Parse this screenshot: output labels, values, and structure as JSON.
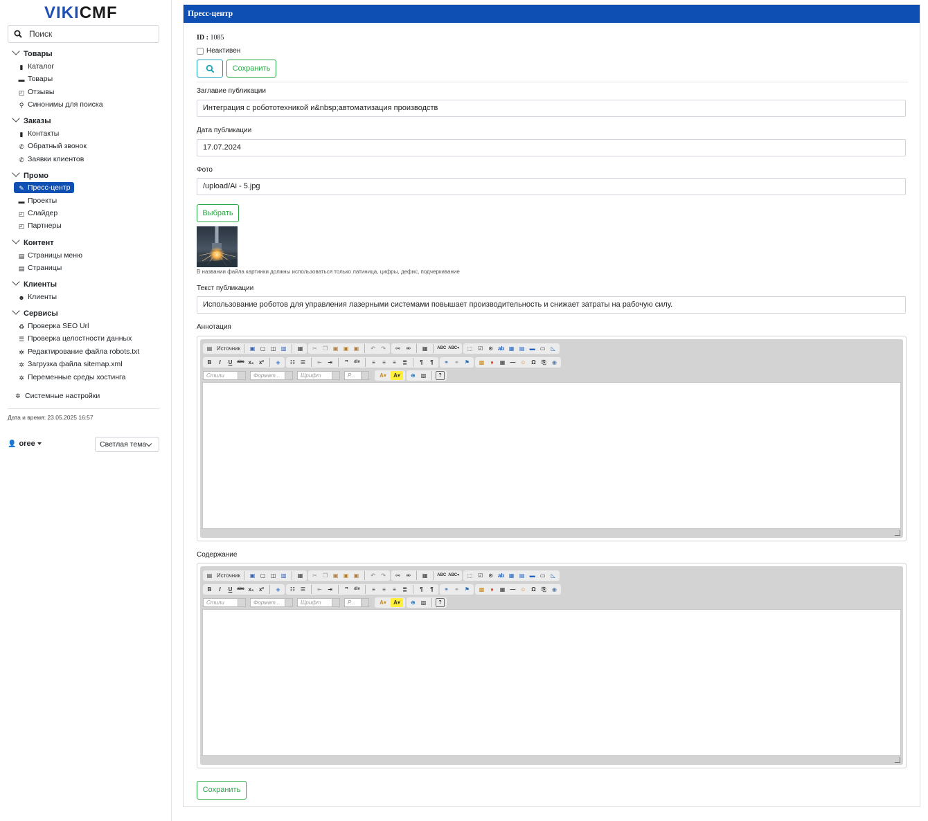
{
  "sidebar": {
    "logo_part1": "VIKI",
    "logo_part2": "CMF",
    "search_placeholder": "Поиск",
    "groups": [
      {
        "title": "Товары",
        "items": [
          "Каталог",
          "Товары",
          "Отзывы",
          "Синонимы для поиска"
        ]
      },
      {
        "title": "Заказы",
        "items": [
          "Контакты",
          "Обратный звонок",
          "Заявки клиентов"
        ]
      },
      {
        "title": "Промо",
        "items": [
          "Пресс-центр",
          "Проекты",
          "Слайдер",
          "Партнеры"
        ]
      },
      {
        "title": "Контент",
        "items": [
          "Страницы меню",
          "Страницы"
        ]
      },
      {
        "title": "Клиенты",
        "items": [
          "Клиенты"
        ]
      },
      {
        "title": "Сервисы",
        "items": [
          "Проверка SEO Url",
          "Проверка целостности данных",
          "Редактирование файла robots.txt",
          "Загрузка файла sitemap.xml",
          "Переменные среды хостинга"
        ]
      }
    ],
    "system_settings": "Системные настройки",
    "datetime": "Дата и время: 23.05.2025 16:57",
    "user": "oree",
    "theme": "Светлая тема"
  },
  "main": {
    "title": "Пресс-центр",
    "id_label": "ID :",
    "id_value": "1085",
    "inactive_label": "Неактивен",
    "save_label": "Сохранить",
    "fields": {
      "title_label": "Заглавие публикации",
      "title_value": "Интеграция с робототехникой и&nbsp;автоматизация производств",
      "date_label": "Дата публикации",
      "date_value": "17.07.2024",
      "photo_label": "Фото",
      "photo_value": "/upload/Ai - 5.jpg",
      "choose_label": "Выбрать",
      "photo_hint": "В названии файла картинки должны использоваться только латиница, цифры, дефис, подчеркивание",
      "text_label": "Текст публикации",
      "text_value": "Использование роботов для управления лазерными системами повышает производительность и снижает затраты на рабочую силу.",
      "annotation_label": "Аннотация",
      "content_label": "Содержание"
    },
    "editor": {
      "source_label": "Источник",
      "styles": "Стили",
      "format": "Формат...",
      "font": "Шрифт",
      "size": "Р..."
    }
  }
}
